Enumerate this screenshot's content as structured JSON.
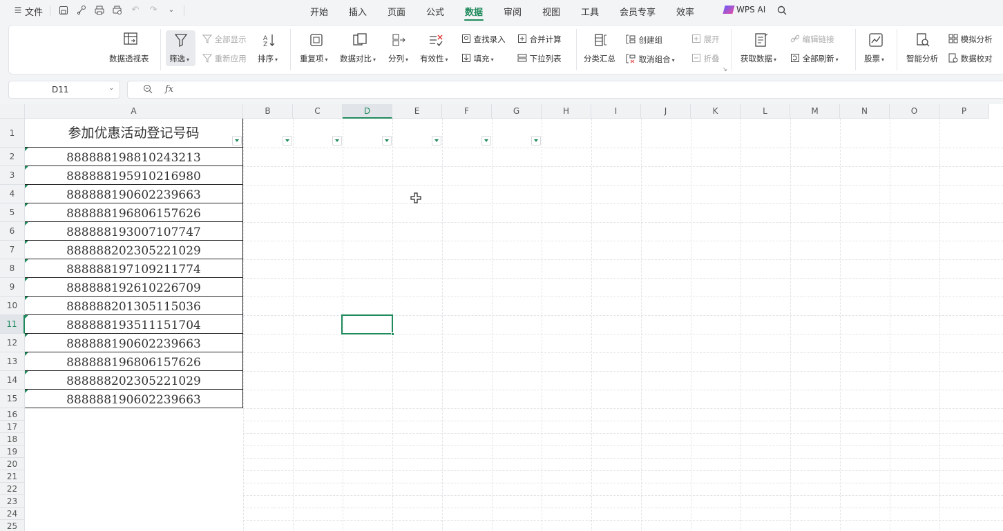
{
  "topbar": {
    "file_label": "文件",
    "menu": [
      "开始",
      "插入",
      "页面",
      "公式",
      "数据",
      "审阅",
      "视图",
      "工具",
      "会员专享",
      "效率"
    ],
    "active_menu": "数据",
    "wps_ai": "WPS AI"
  },
  "ribbon": {
    "pivot": "数据透视表",
    "filter": "筛选",
    "show_all": "全部显示",
    "reapply": "重新应用",
    "sort": "排序",
    "duplicates": "重复项",
    "compare": "数据对比",
    "split": "分列",
    "validity": "有效性",
    "find_entry": "查找录入",
    "fill": "填充",
    "consolidate": "合并计算",
    "dropdown_list": "下拉列表",
    "subtotal": "分类汇总",
    "create_group": "创建组",
    "ungroup": "取消组合",
    "expand": "展开",
    "collapse": "折叠",
    "get_data": "获取数据",
    "edit_links": "编辑链接",
    "refresh_all": "全部刷新",
    "stocks": "股票",
    "smart_analysis": "智能分析",
    "simulate": "模拟分析",
    "verify": "数据校对"
  },
  "formula": {
    "cell_ref": "D11",
    "fx": "fx",
    "value": ""
  },
  "sheet": {
    "columns": [
      "A",
      "B",
      "C",
      "D",
      "E",
      "F",
      "G",
      "H",
      "I",
      "J",
      "K",
      "L",
      "M",
      "N",
      "O",
      "P"
    ],
    "selected_column": "D",
    "selected_row": "11",
    "header_text": "参加优惠活动登记号码",
    "rows": [
      "1",
      "2",
      "3",
      "4",
      "5",
      "6",
      "7",
      "8",
      "9",
      "10",
      "11",
      "12",
      "13",
      "14",
      "15",
      "16",
      "17",
      "18",
      "19",
      "20",
      "21",
      "22",
      "23",
      "24",
      "25"
    ],
    "values": [
      "888888198810243213",
      "888888195910216980",
      "888888190602239663",
      "888888196806157626",
      "888888193007107747",
      "888888202305221029",
      "888888197109211774",
      "888888192610226709",
      "888888201305115036",
      "888888193511151704",
      "888888190602239663",
      "888888196806157626",
      "888888202305221029",
      "888888190602239663"
    ]
  }
}
